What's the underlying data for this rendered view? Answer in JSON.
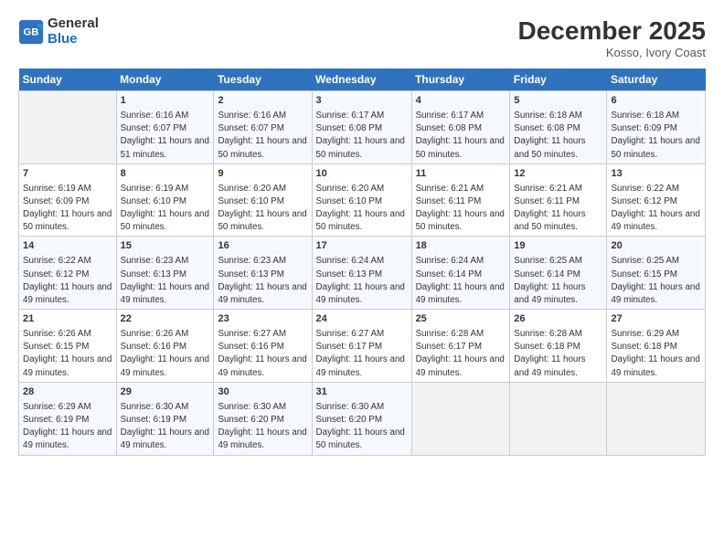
{
  "header": {
    "logo_line1": "General",
    "logo_line2": "Blue",
    "title": "December 2025",
    "subtitle": "Kosso, Ivory Coast"
  },
  "columns": [
    "Sunday",
    "Monday",
    "Tuesday",
    "Wednesday",
    "Thursday",
    "Friday",
    "Saturday"
  ],
  "weeks": [
    [
      {
        "day": "",
        "empty": true
      },
      {
        "day": "1",
        "sunrise": "6:16 AM",
        "sunset": "6:07 PM",
        "daylight": "11 hours and 51 minutes."
      },
      {
        "day": "2",
        "sunrise": "6:16 AM",
        "sunset": "6:07 PM",
        "daylight": "11 hours and 50 minutes."
      },
      {
        "day": "3",
        "sunrise": "6:17 AM",
        "sunset": "6:08 PM",
        "daylight": "11 hours and 50 minutes."
      },
      {
        "day": "4",
        "sunrise": "6:17 AM",
        "sunset": "6:08 PM",
        "daylight": "11 hours and 50 minutes."
      },
      {
        "day": "5",
        "sunrise": "6:18 AM",
        "sunset": "6:08 PM",
        "daylight": "11 hours and 50 minutes."
      },
      {
        "day": "6",
        "sunrise": "6:18 AM",
        "sunset": "6:09 PM",
        "daylight": "11 hours and 50 minutes."
      }
    ],
    [
      {
        "day": "7",
        "sunrise": "6:19 AM",
        "sunset": "6:09 PM",
        "daylight": "11 hours and 50 minutes."
      },
      {
        "day": "8",
        "sunrise": "6:19 AM",
        "sunset": "6:10 PM",
        "daylight": "11 hours and 50 minutes."
      },
      {
        "day": "9",
        "sunrise": "6:20 AM",
        "sunset": "6:10 PM",
        "daylight": "11 hours and 50 minutes."
      },
      {
        "day": "10",
        "sunrise": "6:20 AM",
        "sunset": "6:10 PM",
        "daylight": "11 hours and 50 minutes."
      },
      {
        "day": "11",
        "sunrise": "6:21 AM",
        "sunset": "6:11 PM",
        "daylight": "11 hours and 50 minutes."
      },
      {
        "day": "12",
        "sunrise": "6:21 AM",
        "sunset": "6:11 PM",
        "daylight": "11 hours and 50 minutes."
      },
      {
        "day": "13",
        "sunrise": "6:22 AM",
        "sunset": "6:12 PM",
        "daylight": "11 hours and 49 minutes."
      }
    ],
    [
      {
        "day": "14",
        "sunrise": "6:22 AM",
        "sunset": "6:12 PM",
        "daylight": "11 hours and 49 minutes."
      },
      {
        "day": "15",
        "sunrise": "6:23 AM",
        "sunset": "6:13 PM",
        "daylight": "11 hours and 49 minutes."
      },
      {
        "day": "16",
        "sunrise": "6:23 AM",
        "sunset": "6:13 PM",
        "daylight": "11 hours and 49 minutes."
      },
      {
        "day": "17",
        "sunrise": "6:24 AM",
        "sunset": "6:13 PM",
        "daylight": "11 hours and 49 minutes."
      },
      {
        "day": "18",
        "sunrise": "6:24 AM",
        "sunset": "6:14 PM",
        "daylight": "11 hours and 49 minutes."
      },
      {
        "day": "19",
        "sunrise": "6:25 AM",
        "sunset": "6:14 PM",
        "daylight": "11 hours and 49 minutes."
      },
      {
        "day": "20",
        "sunrise": "6:25 AM",
        "sunset": "6:15 PM",
        "daylight": "11 hours and 49 minutes."
      }
    ],
    [
      {
        "day": "21",
        "sunrise": "6:26 AM",
        "sunset": "6:15 PM",
        "daylight": "11 hours and 49 minutes."
      },
      {
        "day": "22",
        "sunrise": "6:26 AM",
        "sunset": "6:16 PM",
        "daylight": "11 hours and 49 minutes."
      },
      {
        "day": "23",
        "sunrise": "6:27 AM",
        "sunset": "6:16 PM",
        "daylight": "11 hours and 49 minutes."
      },
      {
        "day": "24",
        "sunrise": "6:27 AM",
        "sunset": "6:17 PM",
        "daylight": "11 hours and 49 minutes."
      },
      {
        "day": "25",
        "sunrise": "6:28 AM",
        "sunset": "6:17 PM",
        "daylight": "11 hours and 49 minutes."
      },
      {
        "day": "26",
        "sunrise": "6:28 AM",
        "sunset": "6:18 PM",
        "daylight": "11 hours and 49 minutes."
      },
      {
        "day": "27",
        "sunrise": "6:29 AM",
        "sunset": "6:18 PM",
        "daylight": "11 hours and 49 minutes."
      }
    ],
    [
      {
        "day": "28",
        "sunrise": "6:29 AM",
        "sunset": "6:19 PM",
        "daylight": "11 hours and 49 minutes."
      },
      {
        "day": "29",
        "sunrise": "6:30 AM",
        "sunset": "6:19 PM",
        "daylight": "11 hours and 49 minutes."
      },
      {
        "day": "30",
        "sunrise": "6:30 AM",
        "sunset": "6:20 PM",
        "daylight": "11 hours and 49 minutes."
      },
      {
        "day": "31",
        "sunrise": "6:30 AM",
        "sunset": "6:20 PM",
        "daylight": "11 hours and 50 minutes."
      },
      {
        "day": "",
        "empty": true
      },
      {
        "day": "",
        "empty": true
      },
      {
        "day": "",
        "empty": true
      }
    ]
  ],
  "labels": {
    "sunrise": "Sunrise:",
    "sunset": "Sunset:",
    "daylight": "Daylight:"
  }
}
